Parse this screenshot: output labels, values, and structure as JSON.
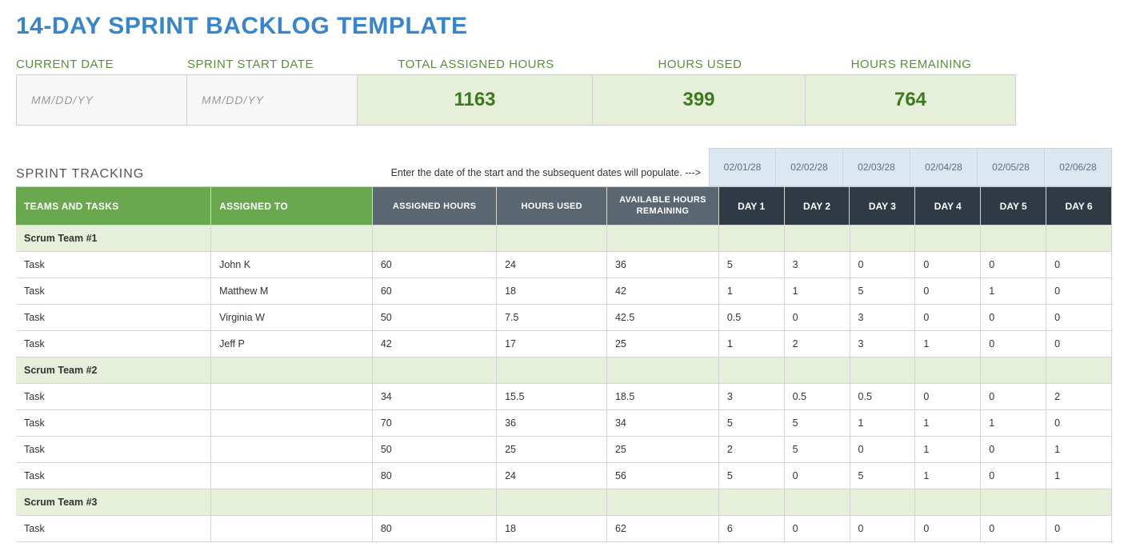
{
  "title": "14-DAY SPRINT BACKLOG TEMPLATE",
  "summary": {
    "labels": {
      "current_date": "CURRENT DATE",
      "sprint_start_date": "SPRINT START DATE",
      "total_assigned_hours": "TOTAL ASSIGNED HOURS",
      "hours_used": "HOURS USED",
      "hours_remaining": "HOURS REMAINING"
    },
    "current_date_placeholder": "MM/DD/YY",
    "sprint_start_date_placeholder": "MM/DD/YY",
    "total_assigned_hours": "1163",
    "hours_used": "399",
    "hours_remaining": "764"
  },
  "tracking": {
    "section_label": "SPRINT TRACKING",
    "hint": "Enter the date of the start and the subsequent dates will populate.  --->",
    "dates": [
      "02/01/28",
      "02/02/28",
      "02/03/28",
      "02/04/28",
      "02/05/28",
      "02/06/28"
    ],
    "headers": {
      "teams_tasks": "TEAMS AND TASKS",
      "assigned_to": "ASSIGNED TO",
      "assigned_hours": "ASSIGNED HOURS",
      "hours_used": "HOURS USED",
      "available_remaining": "AVAILABLE HOURS REMAINING",
      "days": [
        "DAY 1",
        "DAY 2",
        "DAY 3",
        "DAY 4",
        "DAY 5",
        "DAY 6"
      ]
    },
    "rows": [
      {
        "type": "team",
        "name": "Scrum Team #1"
      },
      {
        "type": "task",
        "name": "Task",
        "assignee": "John K",
        "ah": "60",
        "hu": "24",
        "ar": "36",
        "d": [
          "5",
          "3",
          "0",
          "0",
          "0",
          "0"
        ]
      },
      {
        "type": "task",
        "name": "Task",
        "assignee": "Matthew M",
        "ah": "60",
        "hu": "18",
        "ar": "42",
        "d": [
          "1",
          "1",
          "5",
          "0",
          "1",
          "0"
        ]
      },
      {
        "type": "task",
        "name": "Task",
        "assignee": "Virginia W",
        "ah": "50",
        "hu": "7.5",
        "ar": "42.5",
        "d": [
          "0.5",
          "0",
          "3",
          "0",
          "0",
          "0"
        ]
      },
      {
        "type": "task",
        "name": "Task",
        "assignee": "Jeff P",
        "ah": "42",
        "hu": "17",
        "ar": "25",
        "d": [
          "1",
          "2",
          "3",
          "1",
          "0",
          "0"
        ]
      },
      {
        "type": "team",
        "name": "Scrum Team #2"
      },
      {
        "type": "task",
        "name": "Task",
        "assignee": "",
        "ah": "34",
        "hu": "15.5",
        "ar": "18.5",
        "d": [
          "3",
          "0.5",
          "0.5",
          "0",
          "0",
          "2"
        ]
      },
      {
        "type": "task",
        "name": "Task",
        "assignee": "",
        "ah": "70",
        "hu": "36",
        "ar": "34",
        "d": [
          "5",
          "5",
          "1",
          "1",
          "1",
          "0"
        ]
      },
      {
        "type": "task",
        "name": "Task",
        "assignee": "",
        "ah": "50",
        "hu": "25",
        "ar": "25",
        "d": [
          "2",
          "5",
          "0",
          "1",
          "0",
          "1"
        ]
      },
      {
        "type": "task",
        "name": "Task",
        "assignee": "",
        "ah": "80",
        "hu": "24",
        "ar": "56",
        "d": [
          "5",
          "0",
          "5",
          "1",
          "0",
          "1"
        ]
      },
      {
        "type": "team",
        "name": "Scrum Team #3"
      },
      {
        "type": "task",
        "name": "Task",
        "assignee": "",
        "ah": "80",
        "hu": "18",
        "ar": "62",
        "d": [
          "6",
          "0",
          "0",
          "0",
          "0",
          "0"
        ]
      }
    ]
  }
}
